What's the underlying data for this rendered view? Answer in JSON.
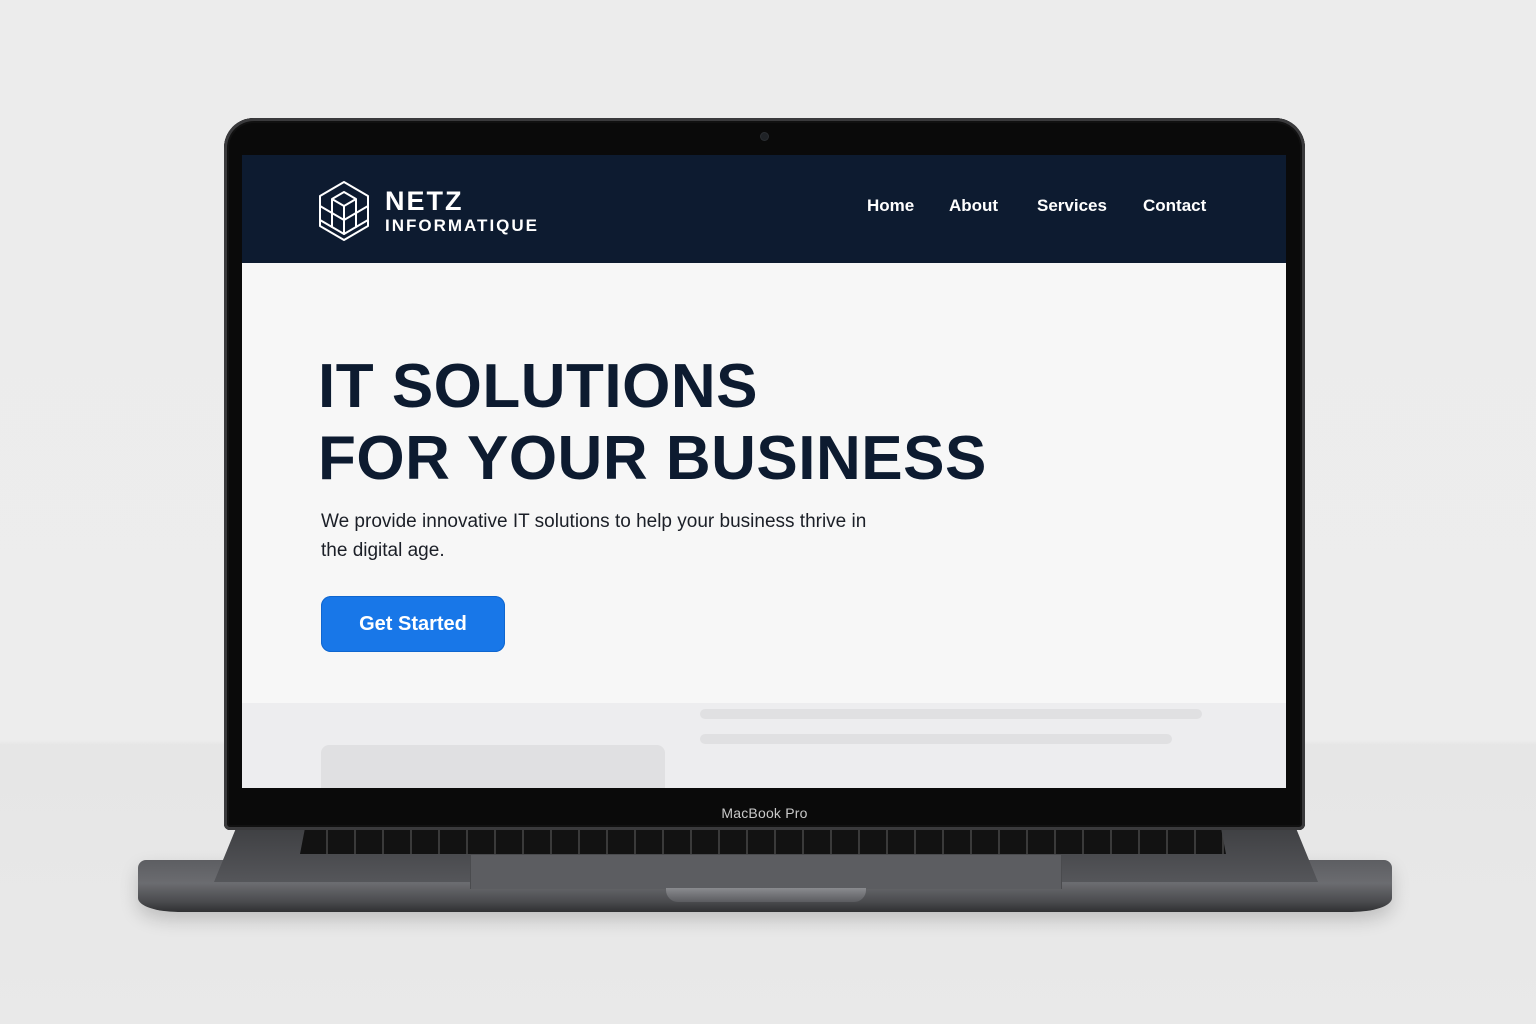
{
  "device": {
    "model_label": "MacBook Pro"
  },
  "site": {
    "brand": {
      "name": "NETZ",
      "tagline": "INFORMATIQUE",
      "logo_icon": "hexagon-cube-logo-icon"
    },
    "nav": {
      "items": [
        {
          "label": "Home"
        },
        {
          "label": "About"
        },
        {
          "label": "Services"
        },
        {
          "label": "Contact"
        }
      ]
    },
    "hero": {
      "title_line1": "IT SOLUTIONS",
      "title_line2": "FOR YOUR BUSINESS",
      "subtitle": "We provide innovative IT solutions to help your business thrive in the digital age.",
      "cta_label": "Get Started"
    },
    "colors": {
      "header_bg": "#0d1b30",
      "title_color": "#0d1b30",
      "cta_bg": "#1877e8",
      "page_bg": "#f7f7f7"
    }
  }
}
